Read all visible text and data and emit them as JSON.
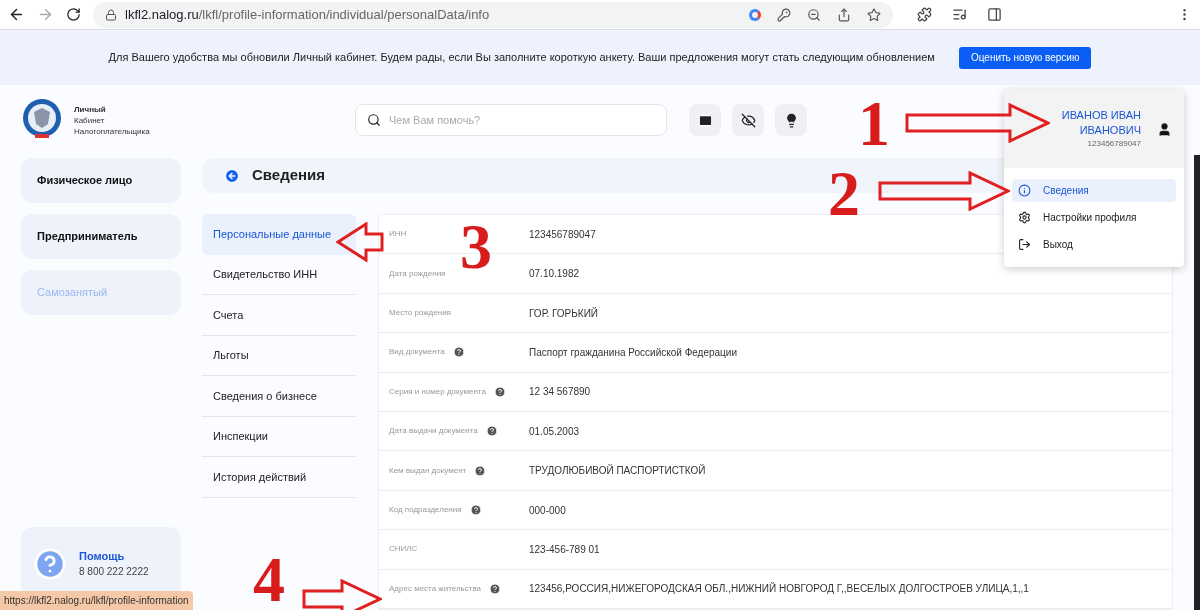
{
  "browser": {
    "url_host": "lkfl2.nalog.ru",
    "url_path": "/lkfl/profile-information/individual/personalData/info"
  },
  "banner": {
    "text": "Для Вашего удобства мы обновили Личный кабинет. Будем рады, если Вы заполните короткую анкету. Ваши предложения могут стать следующим обновлением",
    "button": "Оценить новую версию"
  },
  "logo": {
    "lines": [
      "Личный",
      "Кабинет",
      "Налогоплательщика"
    ]
  },
  "search": {
    "placeholder": "Чем Вам помочь?"
  },
  "sidebar": {
    "items": [
      {
        "label": "Физическое лицо",
        "disabled": false
      },
      {
        "label": "Предприниматель",
        "disabled": false
      },
      {
        "label": "Самозанятый",
        "disabled": true
      }
    ],
    "help": {
      "title": "Помощь",
      "phone": "8 800 222 2222"
    }
  },
  "page": {
    "title": "Сведения"
  },
  "menu": [
    {
      "label": "Персональные данные",
      "selected": true
    },
    {
      "label": "Свидетельство ИНН",
      "selected": false
    },
    {
      "label": "Счета",
      "selected": false
    },
    {
      "label": "Льготы",
      "selected": false
    },
    {
      "label": "Сведения о бизнесе",
      "selected": false
    },
    {
      "label": "Инспекции",
      "selected": false
    },
    {
      "label": "История действий",
      "selected": false
    }
  ],
  "fields": [
    {
      "label": "ИНН",
      "value": "123456789047",
      "help": false
    },
    {
      "label": "Дата рождения",
      "value": "07.10.1982",
      "help": false
    },
    {
      "label": "Место рождения",
      "value": "ГОР. ГОРЬКИЙ",
      "help": false
    },
    {
      "label": "Вид документа",
      "value": "Паспорт гражданина Российской Федерации",
      "help": true
    },
    {
      "label": "Серия и номер документа",
      "value": "12 34 567890",
      "help": true
    },
    {
      "label": "Дата выдачи документа",
      "value": "01.05.2003",
      "help": true
    },
    {
      "label": "Кем выдан документ",
      "value": "ТРУДОЛЮБИВОЙ ПАСПОРТИСТКОЙ",
      "help": true
    },
    {
      "label": "Код подразделения",
      "value": "000-000",
      "help": true
    },
    {
      "label": "СНИЛС",
      "value": "123-456-789 01",
      "help": false
    },
    {
      "label": "Адрес места жительства",
      "value": "123456,РОССИЯ,НИЖЕГОРОДСКАЯ ОБЛ.,НИЖНИЙ НОВГОРОД Г,,ВЕСЕЛЫХ ДОЛГОСТРОЕВ УЛИЦА,1,,1",
      "help": true
    }
  ],
  "profile_menu": {
    "name_lines": [
      "ИВАНОВ ИВАН",
      "ИВАНОВИЧ"
    ],
    "inn": "123456789047",
    "items": [
      {
        "kind": "info",
        "label": "Сведения",
        "selected": true
      },
      {
        "kind": "settings",
        "label": "Настройки профиля",
        "selected": false
      },
      {
        "kind": "logout",
        "label": "Выход",
        "selected": false
      }
    ]
  },
  "annotations": [
    "1",
    "2",
    "3",
    "4"
  ],
  "status_bar": {
    "url": "https://lkfl2.nalog.ru/lkfl/profile-information"
  }
}
